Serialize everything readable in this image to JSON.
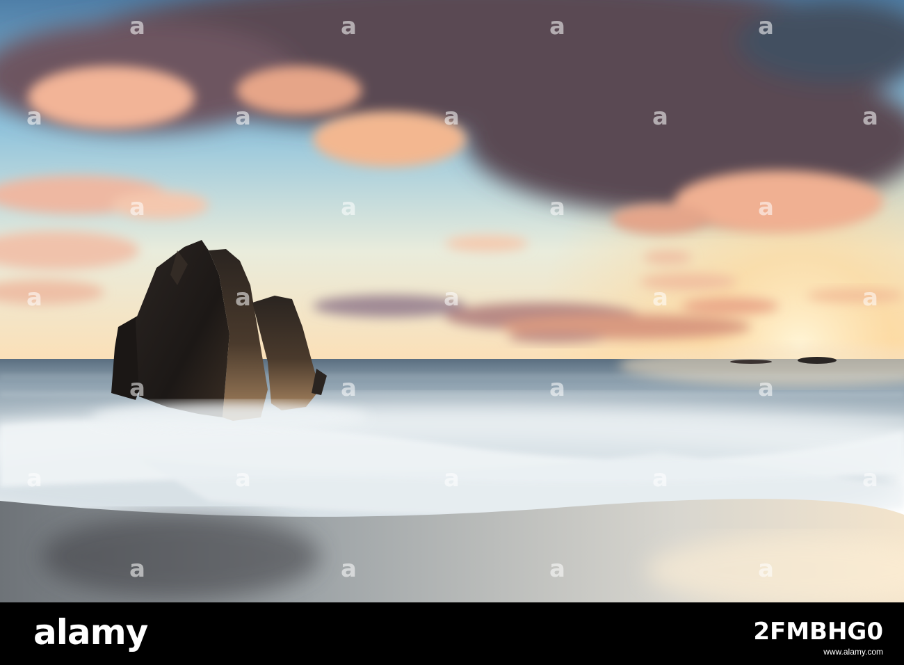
{
  "watermark": {
    "text": "a"
  },
  "footer": {
    "brand": "alamy",
    "image_id": "2FMBHG0",
    "meta": "www.alamy.com"
  }
}
